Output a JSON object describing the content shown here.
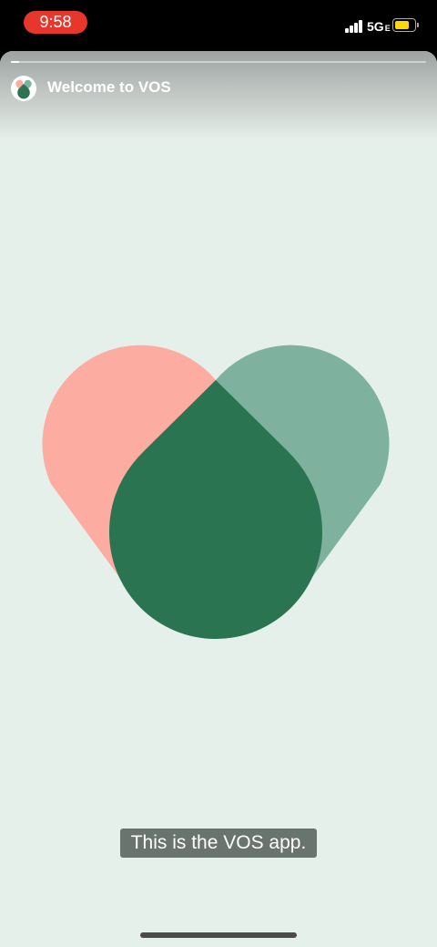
{
  "status_bar": {
    "time": "9:58",
    "network": "5G",
    "network_suffix": "E",
    "battery_level": 0.75,
    "signal_bars": 4,
    "colors": {
      "time_pill": "#e7372d",
      "battery": "#ffd60a"
    }
  },
  "story": {
    "title": "Welcome to VOS",
    "progress": 0.02,
    "background": "#e6f0eb",
    "caption": "This is the VOS app.",
    "logo": {
      "icon": "vos-heart-logo",
      "colors": {
        "left_petal": "#fcaca0",
        "right_petal": "#7eb29f",
        "center_drop": "#2b7452"
      }
    }
  }
}
